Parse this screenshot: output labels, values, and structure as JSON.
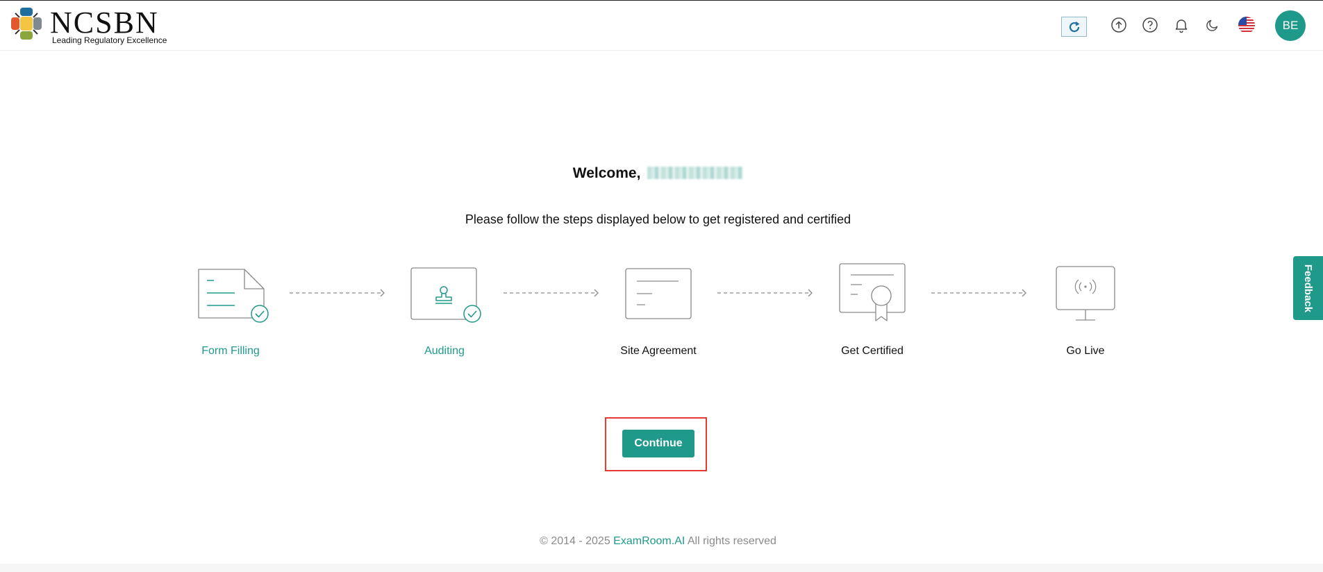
{
  "header": {
    "logo_name": "NCSBN",
    "logo_tagline": "Leading Regulatory Excellence",
    "icons": [
      "refresh-icon",
      "upload-icon",
      "help-icon",
      "bell-icon",
      "moon-icon",
      "us-flag-icon"
    ],
    "avatar_initials": "BE"
  },
  "main": {
    "welcome_prefix": "Welcome,",
    "instructions": "Please follow the steps displayed below to get registered and certified",
    "steps": [
      {
        "label": "Form Filling",
        "icon": "form-document-icon",
        "completed": true
      },
      {
        "label": "Auditing",
        "icon": "stamp-icon",
        "completed": true
      },
      {
        "label": "Site Agreement",
        "icon": "agreement-document-icon",
        "completed": false
      },
      {
        "label": "Get Certified",
        "icon": "certificate-icon",
        "completed": false
      },
      {
        "label": "Go Live",
        "icon": "broadcast-monitor-icon",
        "completed": false
      }
    ],
    "continue_label": "Continue"
  },
  "feedback_label": "Feedback",
  "footer": {
    "prefix": "© 2014 - 2025",
    "brand": "ExamRoom.AI",
    "suffix": "All rights reserved"
  },
  "colors": {
    "accent": "#1f9a8a",
    "highlight_frame": "#e53935"
  }
}
